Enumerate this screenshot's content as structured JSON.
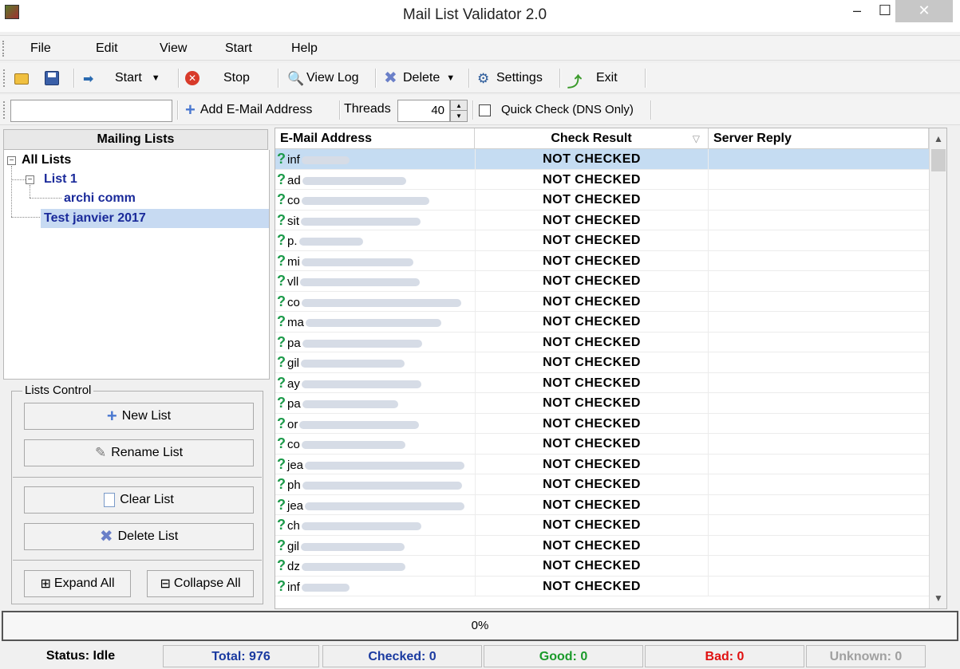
{
  "window": {
    "title": "Mail List Validator 2.0",
    "min": "–",
    "max": "☐",
    "close": "✕"
  },
  "menu": [
    "File",
    "Edit",
    "View",
    "Start",
    "Help"
  ],
  "toolbar": {
    "start_label": "Start",
    "stop_label": "Stop",
    "view_log_label": "View Log",
    "delete_label": "Delete",
    "settings_label": "Settings",
    "exit_label": "Exit"
  },
  "toolbar2": {
    "address_value": "",
    "add_label": "Add E-Mail Address",
    "threads_label": "Threads",
    "threads_value": "40",
    "quick_check_label": "Quick Check (DNS Only)",
    "quick_check_checked": false
  },
  "left": {
    "header": "Mailing Lists",
    "tree": {
      "root": "All Lists",
      "list1": "List 1",
      "child": "archi comm",
      "selected": "Test janvier 2017"
    },
    "lists_control_title": "Lists Control",
    "new_list": "New List",
    "rename_list": "Rename List",
    "clear_list": "Clear List",
    "delete_list": "Delete List",
    "expand_all": "Expand All",
    "collapse_all": "Collapse All"
  },
  "grid": {
    "columns": [
      "E-Mail Address",
      "Check Result",
      "Server Reply"
    ],
    "rows": [
      {
        "prefix": "inf",
        "blur_len": 60,
        "result": "NOT CHECKED",
        "selected": true
      },
      {
        "prefix": "ad",
        "blur_len": 130,
        "result": "NOT CHECKED"
      },
      {
        "prefix": "co",
        "blur_len": 160,
        "result": "NOT CHECKED"
      },
      {
        "prefix": "sit",
        "blur_len": 150,
        "result": "NOT CHECKED"
      },
      {
        "prefix": "p.",
        "blur_len": 80,
        "result": "NOT CHECKED"
      },
      {
        "prefix": "mi",
        "blur_len": 140,
        "result": "NOT CHECKED"
      },
      {
        "prefix": "vll",
        "blur_len": 150,
        "result": "NOT CHECKED"
      },
      {
        "prefix": "co",
        "blur_len": 200,
        "result": "NOT CHECKED"
      },
      {
        "prefix": "ma",
        "blur_len": 170,
        "result": "NOT CHECKED"
      },
      {
        "prefix": "pa",
        "blur_len": 150,
        "result": "NOT CHECKED"
      },
      {
        "prefix": "gil",
        "blur_len": 130,
        "result": "NOT CHECKED"
      },
      {
        "prefix": "ay",
        "blur_len": 150,
        "result": "NOT CHECKED"
      },
      {
        "prefix": "pa",
        "blur_len": 120,
        "result": "NOT CHECKED"
      },
      {
        "prefix": "or",
        "blur_len": 150,
        "result": "NOT CHECKED"
      },
      {
        "prefix": "co",
        "blur_len": 130,
        "result": "NOT CHECKED"
      },
      {
        "prefix": "jea",
        "blur_len": 200,
        "result": "NOT CHECKED"
      },
      {
        "prefix": "ph",
        "blur_len": 200,
        "result": "NOT CHECKED"
      },
      {
        "prefix": "jea",
        "blur_len": 200,
        "result": "NOT CHECKED"
      },
      {
        "prefix": "ch",
        "blur_len": 150,
        "result": "NOT CHECKED"
      },
      {
        "prefix": "gil",
        "blur_len": 130,
        "result": "NOT CHECKED"
      },
      {
        "prefix": "dz",
        "blur_len": 130,
        "result": "NOT CHECKED"
      },
      {
        "prefix": "inf",
        "blur_len": 60,
        "result": "NOT CHECKED"
      }
    ]
  },
  "progress": {
    "value": 0,
    "label": "0%"
  },
  "status": {
    "status": "Status: Idle",
    "total": "Total: 976",
    "checked": "Checked: 0",
    "good": "Good: 0",
    "bad": "Bad: 0",
    "unknown": "Unknown: 0"
  },
  "colors": {
    "selection": "#c5dcf2",
    "good": "#1a9a2a",
    "bad": "#e01010",
    "info": "#1a3aa0"
  }
}
